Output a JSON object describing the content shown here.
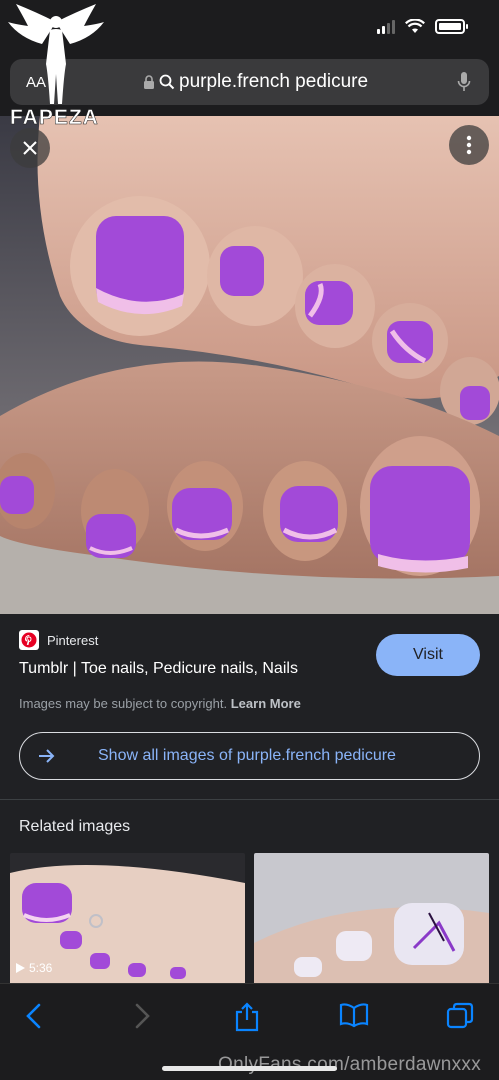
{
  "status_bar": {
    "time": ""
  },
  "watermark": {
    "logo_text": "FAPEZA",
    "footer": "OnlyFans.com/amberdawnxxx"
  },
  "url_bar": {
    "aa_label": "AA",
    "query": "purple.french pedicure"
  },
  "image": {
    "subject": "purple-french-pedicure-photo"
  },
  "result": {
    "source": "Pinterest",
    "title": "Tumblr | Toe nails, Pedicure nails, Nails",
    "visit_label": "Visit",
    "copyright_text": "Images may be subject to copyright.",
    "learn_more": "Learn More",
    "show_all_label": "Show all images of purple.french pedicure"
  },
  "related": {
    "heading": "Related images",
    "items": [
      {
        "duration": "5:36"
      },
      {
        "duration": ""
      }
    ]
  },
  "colors": {
    "accent": "#8ab4f8",
    "background": "#202124",
    "nail_purple": "#a24ad8"
  }
}
